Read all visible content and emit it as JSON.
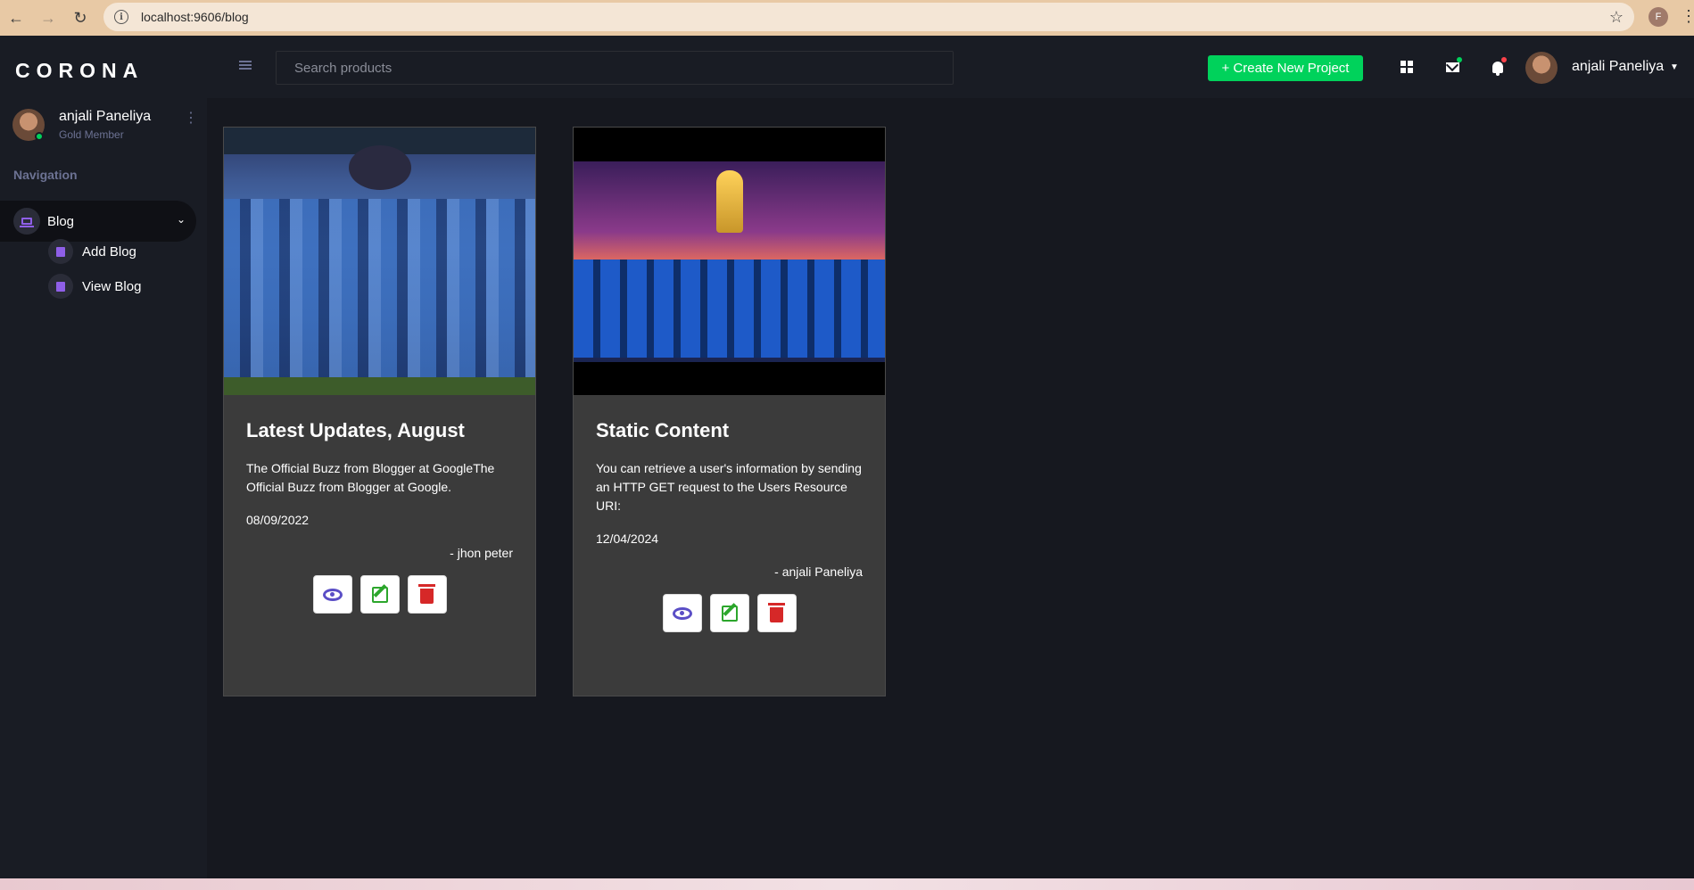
{
  "browser": {
    "url": "localhost:9606/blog",
    "profile_initial": "F"
  },
  "sidebar": {
    "brand": "CORONA",
    "user": {
      "name": "anjali Paneliya",
      "role": "Gold Member"
    },
    "nav_heading": "Navigation",
    "items": [
      {
        "label": "Blog",
        "icon": "laptop-icon",
        "expanded": true,
        "children": [
          {
            "label": "Add Blog",
            "icon": "document-icon"
          },
          {
            "label": "View Blog",
            "icon": "document-icon"
          }
        ]
      }
    ]
  },
  "navbar": {
    "search_placeholder": "Search products",
    "create_button": "+ Create New Project",
    "username": "anjali Paneliya",
    "accent_color": "#00d25b",
    "notification_color": "#fc424a"
  },
  "posts": [
    {
      "title": "Latest Updates, August",
      "description": "The Official Buzz from Blogger at GoogleThe Official Buzz from Blogger at Google.",
      "date": "08/09/2022",
      "author": "- jhon peter"
    },
    {
      "title": "Static Content",
      "description": "You can retrieve a user's information by sending an HTTP GET request to the Users Resource URI:",
      "date": "12/04/2024",
      "author": "- anjali Paneliya"
    }
  ]
}
